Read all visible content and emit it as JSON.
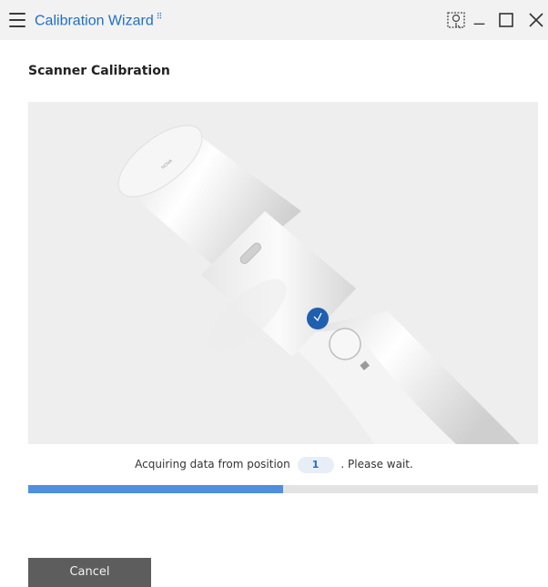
{
  "window": {
    "title": "Calibration Wizard",
    "title_badge": "⠿",
    "icons": [
      "menu-icon",
      "screenshot-icon",
      "minimize-icon",
      "maximize-icon",
      "close-icon"
    ]
  },
  "header": {
    "section_title": "Scanner Calibration"
  },
  "status": {
    "prefix": "Acquiring data from position",
    "position": "1",
    "suffix": ". Please wait."
  },
  "progress": {
    "fraction": 0.5,
    "color": "#4f8fdd"
  },
  "buttons": {
    "cancel_label": "Cancel"
  },
  "colors": {
    "accent": "#1f6fc5",
    "titlebar_bg": "#f2f2f2",
    "panel_bg": "#eeeeee",
    "button_bg": "#5d5d5d"
  }
}
